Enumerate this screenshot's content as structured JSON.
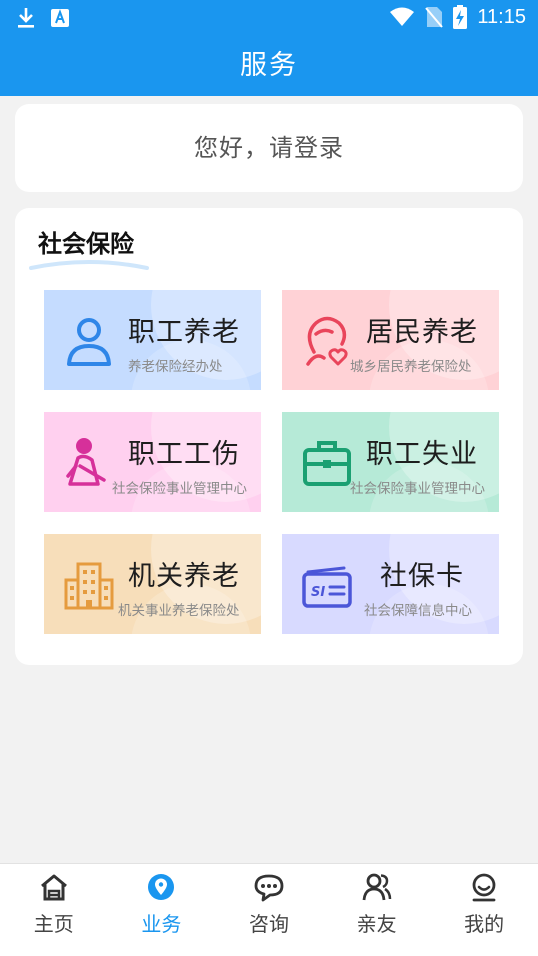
{
  "status_bar": {
    "time": "11:15"
  },
  "header": {
    "title": "服务"
  },
  "login": {
    "prompt": "您好，请登录"
  },
  "social_insurance": {
    "heading": "社会保险",
    "tiles": [
      {
        "name": "职工养老",
        "subtitle": "养老保险经办处",
        "icon": "person-icon"
      },
      {
        "name": "居民养老",
        "subtitle": "城乡居民养老保险处",
        "icon": "resident-heart-icon"
      },
      {
        "name": "职工工伤",
        "subtitle": "社会保险事业管理中心",
        "icon": "injury-icon"
      },
      {
        "name": "职工失业",
        "subtitle": "社会保险事业管理中心",
        "icon": "briefcase-icon"
      },
      {
        "name": "机关养老",
        "subtitle": "机关事业养老保险处",
        "icon": "building-icon"
      },
      {
        "name": "社保卡",
        "subtitle": "社会保障信息中心",
        "icon": "si-card-icon"
      }
    ]
  },
  "bottom_nav": {
    "items": [
      {
        "label": "主页",
        "icon": "home-icon"
      },
      {
        "label": "业务",
        "icon": "location-pin-icon",
        "active": true
      },
      {
        "label": "咨询",
        "icon": "chat-bubble-icon"
      },
      {
        "label": "亲友",
        "icon": "contacts-icon"
      },
      {
        "label": "我的",
        "icon": "profile-icon"
      }
    ]
  },
  "colors": {
    "primary": "#1a96ef",
    "background": "#f2f2f2"
  }
}
